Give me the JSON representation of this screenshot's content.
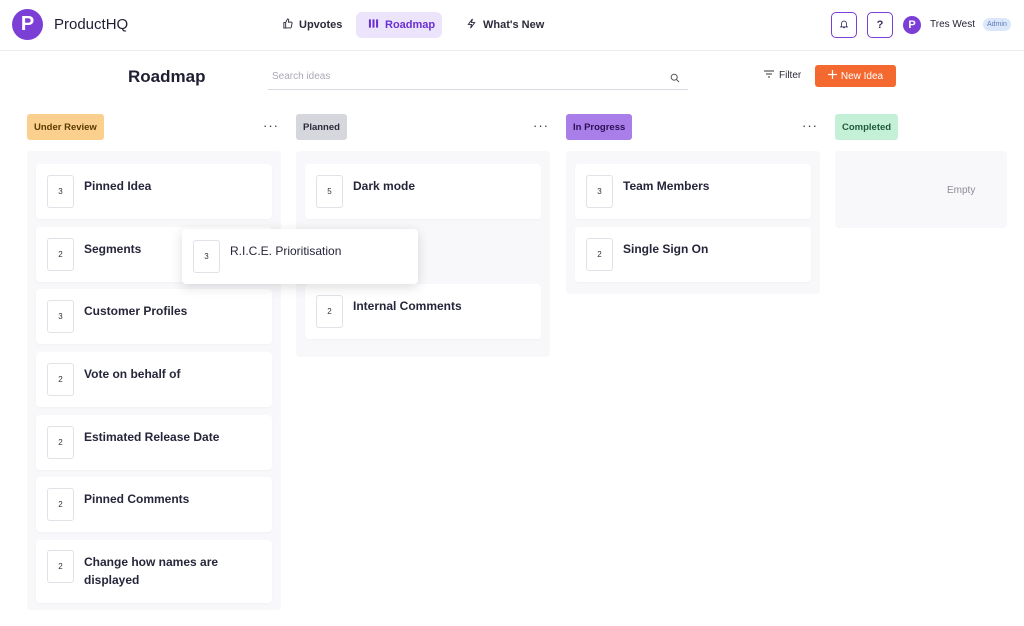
{
  "app": {
    "brand": "ProductHQ",
    "logo_letter": "P"
  },
  "nav": {
    "tabs": [
      {
        "label": "Upvotes",
        "icon": "thumbs-up-icon"
      },
      {
        "label": "Roadmap",
        "icon": "columns-icon",
        "active": true
      },
      {
        "label": "What's New",
        "icon": "lightning-icon"
      }
    ]
  },
  "header": {
    "bell_icon": "bell-icon",
    "help_label": "?",
    "avatar_letter": "P",
    "user_name": "Tres West",
    "user_role": "Admin"
  },
  "toolbar": {
    "title": "Roadmap",
    "search_placeholder": "Search ideas",
    "filter_label": "Filter",
    "new_label": "New Idea"
  },
  "colors": {
    "brand": "#7b3fd6",
    "accent": "#f4692f",
    "under_review": "#fbd08f",
    "planned": "#d6d6dd",
    "in_progress": "#a97ee8",
    "completed": "#c5f0d8"
  },
  "columns": [
    {
      "title": "Under Review",
      "cards": [
        {
          "votes": "3",
          "title": "Pinned Idea"
        },
        {
          "votes": "2",
          "title": "Segments"
        },
        {
          "votes": "3",
          "title": "Customer Profiles"
        },
        {
          "votes": "2",
          "title": "Vote on behalf of"
        },
        {
          "votes": "2",
          "title": "Estimated Release Date"
        },
        {
          "votes": "2",
          "title": "Pinned Comments"
        },
        {
          "votes": "2",
          "title": "Change how names are displayed"
        }
      ]
    },
    {
      "title": "Planned",
      "cards": [
        {
          "votes": "5",
          "title": "Dark mode"
        },
        {
          "votes": "2",
          "title": "Internal Comments"
        }
      ]
    },
    {
      "title": "In Progress",
      "cards": [
        {
          "votes": "3",
          "title": "Team Members"
        },
        {
          "votes": "2",
          "title": "Single Sign On"
        }
      ]
    },
    {
      "title": "Completed",
      "empty_label": "Empty",
      "cards": []
    }
  ],
  "dragging": {
    "votes": "3",
    "title": "R.I.C.E. Prioritisation"
  }
}
